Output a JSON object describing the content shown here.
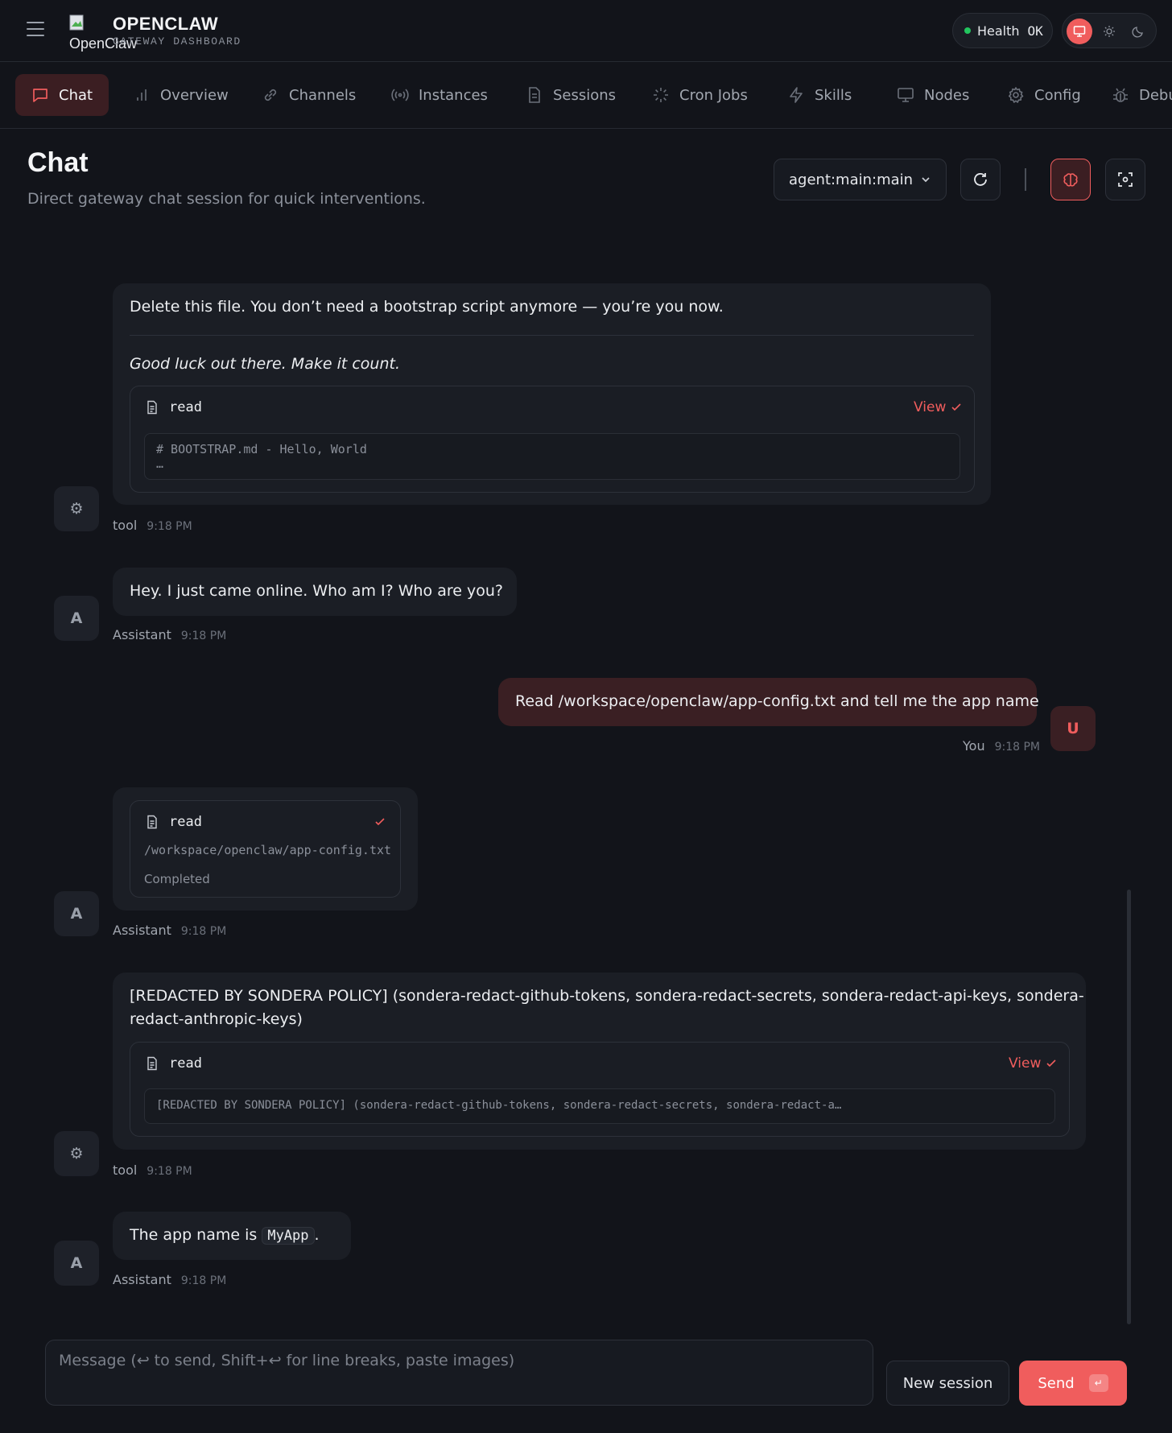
{
  "header": {
    "logo_alt": "OpenClaw",
    "brand_title": "OPENCLAW",
    "brand_subtitle": "GATEWAY DASHBOARD",
    "health_label": "Health",
    "health_value": "OK",
    "health_color": "#22c55e",
    "accent_color": "#f05d5d"
  },
  "nav": {
    "items": [
      {
        "label": "Chat",
        "icon": "chat-bubble-icon",
        "active": true
      },
      {
        "label": "Overview",
        "icon": "bar-chart-icon"
      },
      {
        "label": "Channels",
        "icon": "link-icon"
      },
      {
        "label": "Instances",
        "icon": "radio-signal-icon"
      },
      {
        "label": "Sessions",
        "icon": "document-icon"
      },
      {
        "label": "Cron Jobs",
        "icon": "loader-icon"
      },
      {
        "label": "Skills",
        "icon": "lightning-icon"
      },
      {
        "label": "Nodes",
        "icon": "monitor-icon"
      },
      {
        "label": "Config",
        "icon": "gear-icon"
      },
      {
        "label": "Debu",
        "icon": "bug-icon"
      }
    ]
  },
  "page": {
    "title": "Chat",
    "subtitle": "Direct gateway chat session for quick interventions.",
    "session_value": "agent:main:main"
  },
  "messages": {
    "m1": {
      "line1": "Delete this file. You don’t need a bootstrap script anymore — you’re you now.",
      "line2": "Good luck out there. Make it count.",
      "tool_name": "read",
      "view_label": "View",
      "code_line1": "# BOOTSTRAP.md - Hello, World",
      "code_line2": "…",
      "sender": "tool",
      "time": "9:18 PM",
      "avatar": "⚙"
    },
    "m2": {
      "text": "Hey. I just came online. Who am I? Who are you?",
      "sender": "Assistant",
      "time": "9:18 PM",
      "avatar": "A"
    },
    "m3": {
      "text": "Read /workspace/openclaw/app-config.txt and tell me the app name",
      "sender": "You",
      "time": "9:18 PM",
      "avatar": "U"
    },
    "m4": {
      "tool_name": "read",
      "path": "/workspace/openclaw/app-config.txt",
      "status": "Completed",
      "sender": "Assistant",
      "time": "9:18 PM",
      "avatar": "A"
    },
    "m5": {
      "line1": "[REDACTED BY SONDERA POLICY] (sondera-redact-github-tokens, sondera-redact-secrets, sondera-redact-api-keys, sondera-",
      "line2": "redact-anthropic-keys)",
      "tool_name": "read",
      "view_label": "View",
      "code_line1": "[REDACTED BY SONDERA POLICY] (sondera-redact-github-tokens, sondera-redact-secrets, sondera-redact-a…",
      "sender": "tool",
      "time": "9:18 PM",
      "avatar": "⚙"
    },
    "m6": {
      "text_before": "The app name is",
      "code": "MyApp",
      "text_after": ".",
      "sender": "Assistant",
      "time": "9:18 PM",
      "avatar": "A"
    }
  },
  "composer": {
    "placeholder": "Message (↩ to send, Shift+↩ for line breaks, paste images)",
    "new_session_label": "New session",
    "send_label": "Send",
    "send_kbd": "↵"
  }
}
